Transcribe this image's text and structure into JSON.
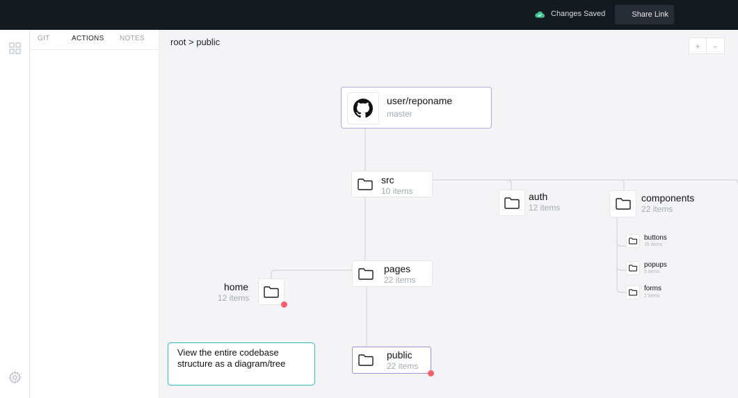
{
  "topbar": {
    "status_text": "Changes Saved",
    "status_color": "#3ec28f",
    "share_label": "Share Link"
  },
  "rail": {
    "top_icon": "grid-icon",
    "bottom_icon": "gear-icon"
  },
  "panel": {
    "tabs": [
      {
        "label": "GIT",
        "active": false
      },
      {
        "label": "ACTIONS",
        "active": true
      },
      {
        "label": "NOTES",
        "active": false
      }
    ]
  },
  "canvas": {
    "breadcrumb": "root > public",
    "zoom_in": "+",
    "zoom_out": "-"
  },
  "tree": {
    "repo": {
      "name": "user/reponame",
      "branch": "master"
    },
    "src": {
      "name": "src",
      "count": "10 items"
    },
    "auth": {
      "name": "auth",
      "count": "12 items"
    },
    "components": {
      "name": "components",
      "count": "22 items"
    },
    "buttons": {
      "name": "buttons",
      "count": "15 items"
    },
    "popups": {
      "name": "popups",
      "count": "5 items"
    },
    "forms": {
      "name": "forms",
      "count": "2 items"
    },
    "pages": {
      "name": "pages",
      "count": "22 items"
    },
    "home": {
      "name": "home",
      "count": "12 items"
    },
    "public": {
      "name": "public",
      "count": "22 items"
    }
  },
  "tip": {
    "text": "View the entire codebase structure as a diagram/tree"
  },
  "colors": {
    "selected_border": "#9b8fd9",
    "tip_border": "#2cb9c9",
    "dot": "#f2626a"
  }
}
